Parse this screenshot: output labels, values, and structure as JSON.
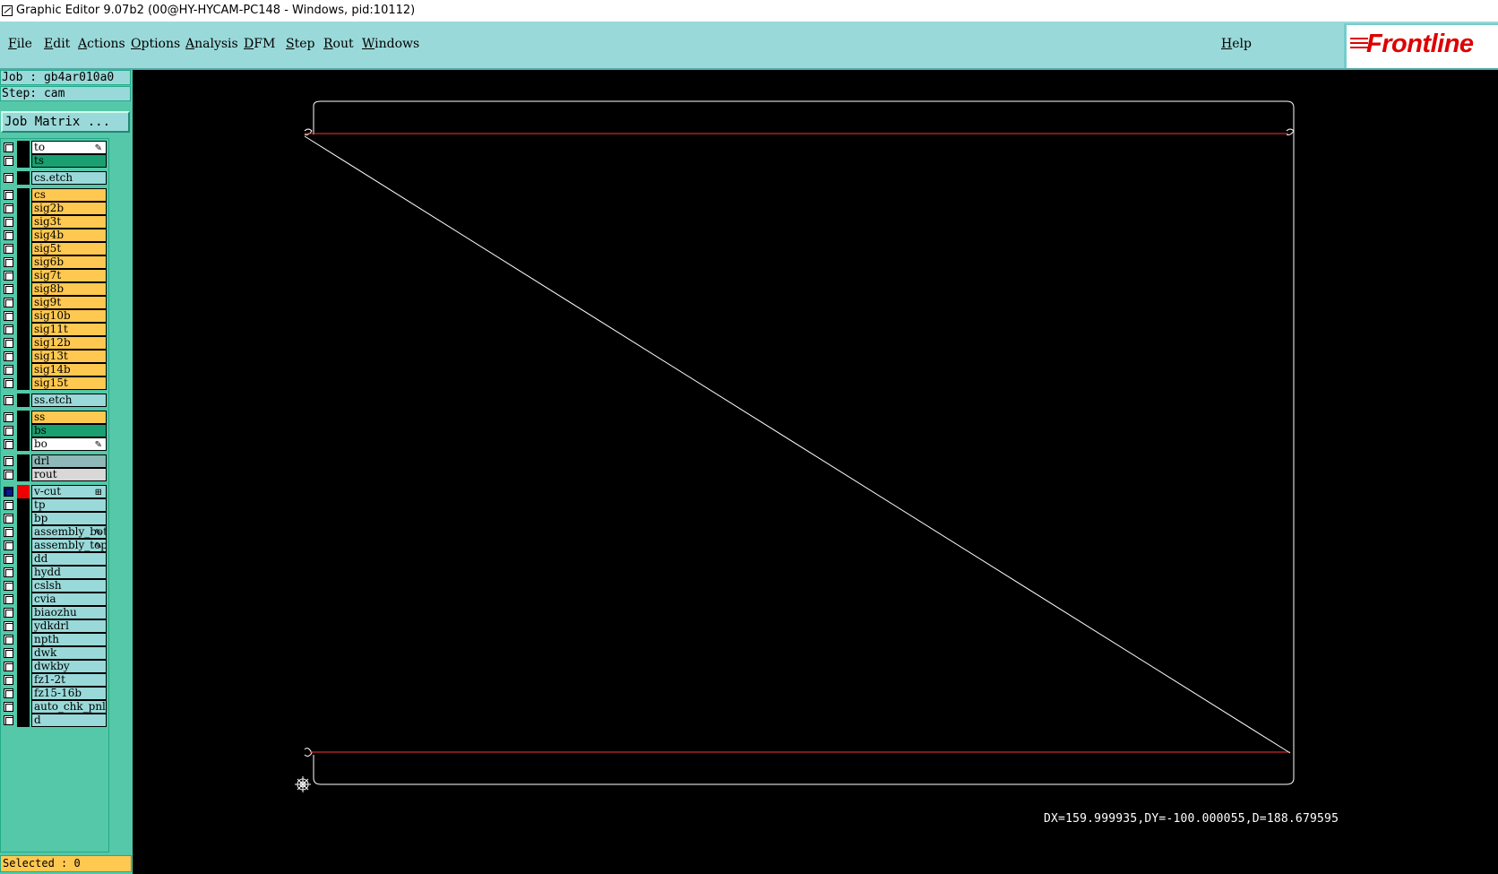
{
  "window": {
    "title": "Graphic Editor 9.07b2 (00@HY-HYCAM-PC148 - Windows, pid:10112)"
  },
  "menubar": {
    "items": [
      "File",
      "Edit",
      "Actions",
      "Options",
      "Analysis",
      "DFM",
      "Step",
      "Rout",
      "Windows"
    ],
    "help": "Help",
    "logo": "Frontline"
  },
  "panel": {
    "job": "Job : gb4ar010a0",
    "step": "Step: cam",
    "job_matrix": "Job Matrix ...",
    "selected": "Selected : 0"
  },
  "layers": [
    {
      "name": "to",
      "color": "#ffffff",
      "mark": "✎"
    },
    {
      "name": "ts",
      "color": "#1aa070"
    },
    {
      "name": "cs.etch",
      "color": "#9ad9d9"
    },
    {
      "name": "cs",
      "color": "#ffc850"
    },
    {
      "name": "sig2b",
      "color": "#ffc850"
    },
    {
      "name": "sig3t",
      "color": "#ffc850"
    },
    {
      "name": "sig4b",
      "color": "#ffc850"
    },
    {
      "name": "sig5t",
      "color": "#ffc850"
    },
    {
      "name": "sig6b",
      "color": "#ffc850"
    },
    {
      "name": "sig7t",
      "color": "#ffc850"
    },
    {
      "name": "sig8b",
      "color": "#ffc850"
    },
    {
      "name": "sig9t",
      "color": "#ffc850"
    },
    {
      "name": "sig10b",
      "color": "#ffc850"
    },
    {
      "name": "sig11t",
      "color": "#ffc850"
    },
    {
      "name": "sig12b",
      "color": "#ffc850"
    },
    {
      "name": "sig13t",
      "color": "#ffc850"
    },
    {
      "name": "sig14b",
      "color": "#ffc850"
    },
    {
      "name": "sig15t",
      "color": "#ffc850"
    },
    {
      "name": "ss.etch",
      "color": "#9ad9d9"
    },
    {
      "name": "ss",
      "color": "#ffc850"
    },
    {
      "name": "bs",
      "color": "#1aa070"
    },
    {
      "name": "bo",
      "color": "#ffffff",
      "mark": "✎"
    },
    {
      "name": "drl",
      "color": "#8fb8b8"
    },
    {
      "name": "rout",
      "color": "#d8d8d8"
    },
    {
      "name": "v-cut",
      "color": "#9ad9d9",
      "active": true,
      "mark": "⊞"
    },
    {
      "name": "tp",
      "color": "#9ad9d9"
    },
    {
      "name": "bp",
      "color": "#9ad9d9"
    },
    {
      "name": "assembly_bot",
      "color": "#9ad9d9",
      "mark": "✎"
    },
    {
      "name": "assembly_top",
      "color": "#9ad9d9",
      "mark": "✎"
    },
    {
      "name": "dd",
      "color": "#9ad9d9"
    },
    {
      "name": "hydd",
      "color": "#9ad9d9"
    },
    {
      "name": "cslsh",
      "color": "#9ad9d9"
    },
    {
      "name": "cvia",
      "color": "#9ad9d9"
    },
    {
      "name": "biaozhu",
      "color": "#9ad9d9"
    },
    {
      "name": "ydkdrl",
      "color": "#9ad9d9"
    },
    {
      "name": "npth",
      "color": "#9ad9d9"
    },
    {
      "name": "dwk",
      "color": "#9ad9d9"
    },
    {
      "name": "dwkby",
      "color": "#9ad9d9"
    },
    {
      "name": "fz1-2t",
      "color": "#9ad9d9"
    },
    {
      "name": "fz15-16b",
      "color": "#9ad9d9"
    },
    {
      "name": "auto_chk_pnl",
      "color": "#9ad9d9"
    },
    {
      "name": "d",
      "color": "#9ad9d9"
    }
  ],
  "canvas": {
    "measure": "DX=159.999935,DY=-100.000055,D=188.679595",
    "line_color": "#ffffff",
    "vcut_color": "#ff3030"
  }
}
